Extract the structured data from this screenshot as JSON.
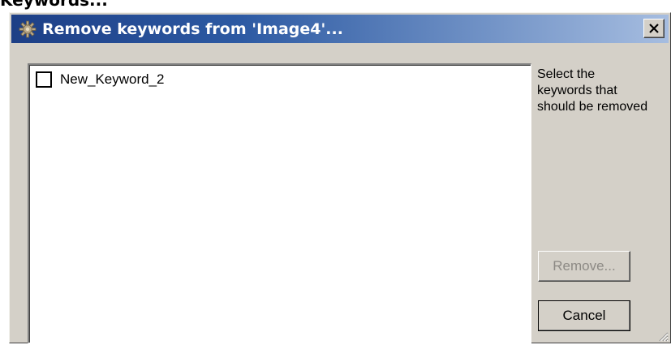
{
  "page": {
    "heading": "Keywords..."
  },
  "dialog": {
    "title": "Remove keywords from 'Image4'...",
    "title_icon": "gear-icon",
    "close_icon": "close-icon",
    "keywords": [
      {
        "label": "New_Keyword_2",
        "checked": false
      }
    ],
    "instructions": "Select the keywords that should be removed",
    "remove_label": "Remove...",
    "remove_enabled": false,
    "cancel_label": "Cancel"
  },
  "colors": {
    "titlebar_start": "#1d3f86",
    "titlebar_end": "#a6bde0",
    "dialog_bg": "#d4d0c8",
    "disabled_text": "#8d8a85"
  }
}
